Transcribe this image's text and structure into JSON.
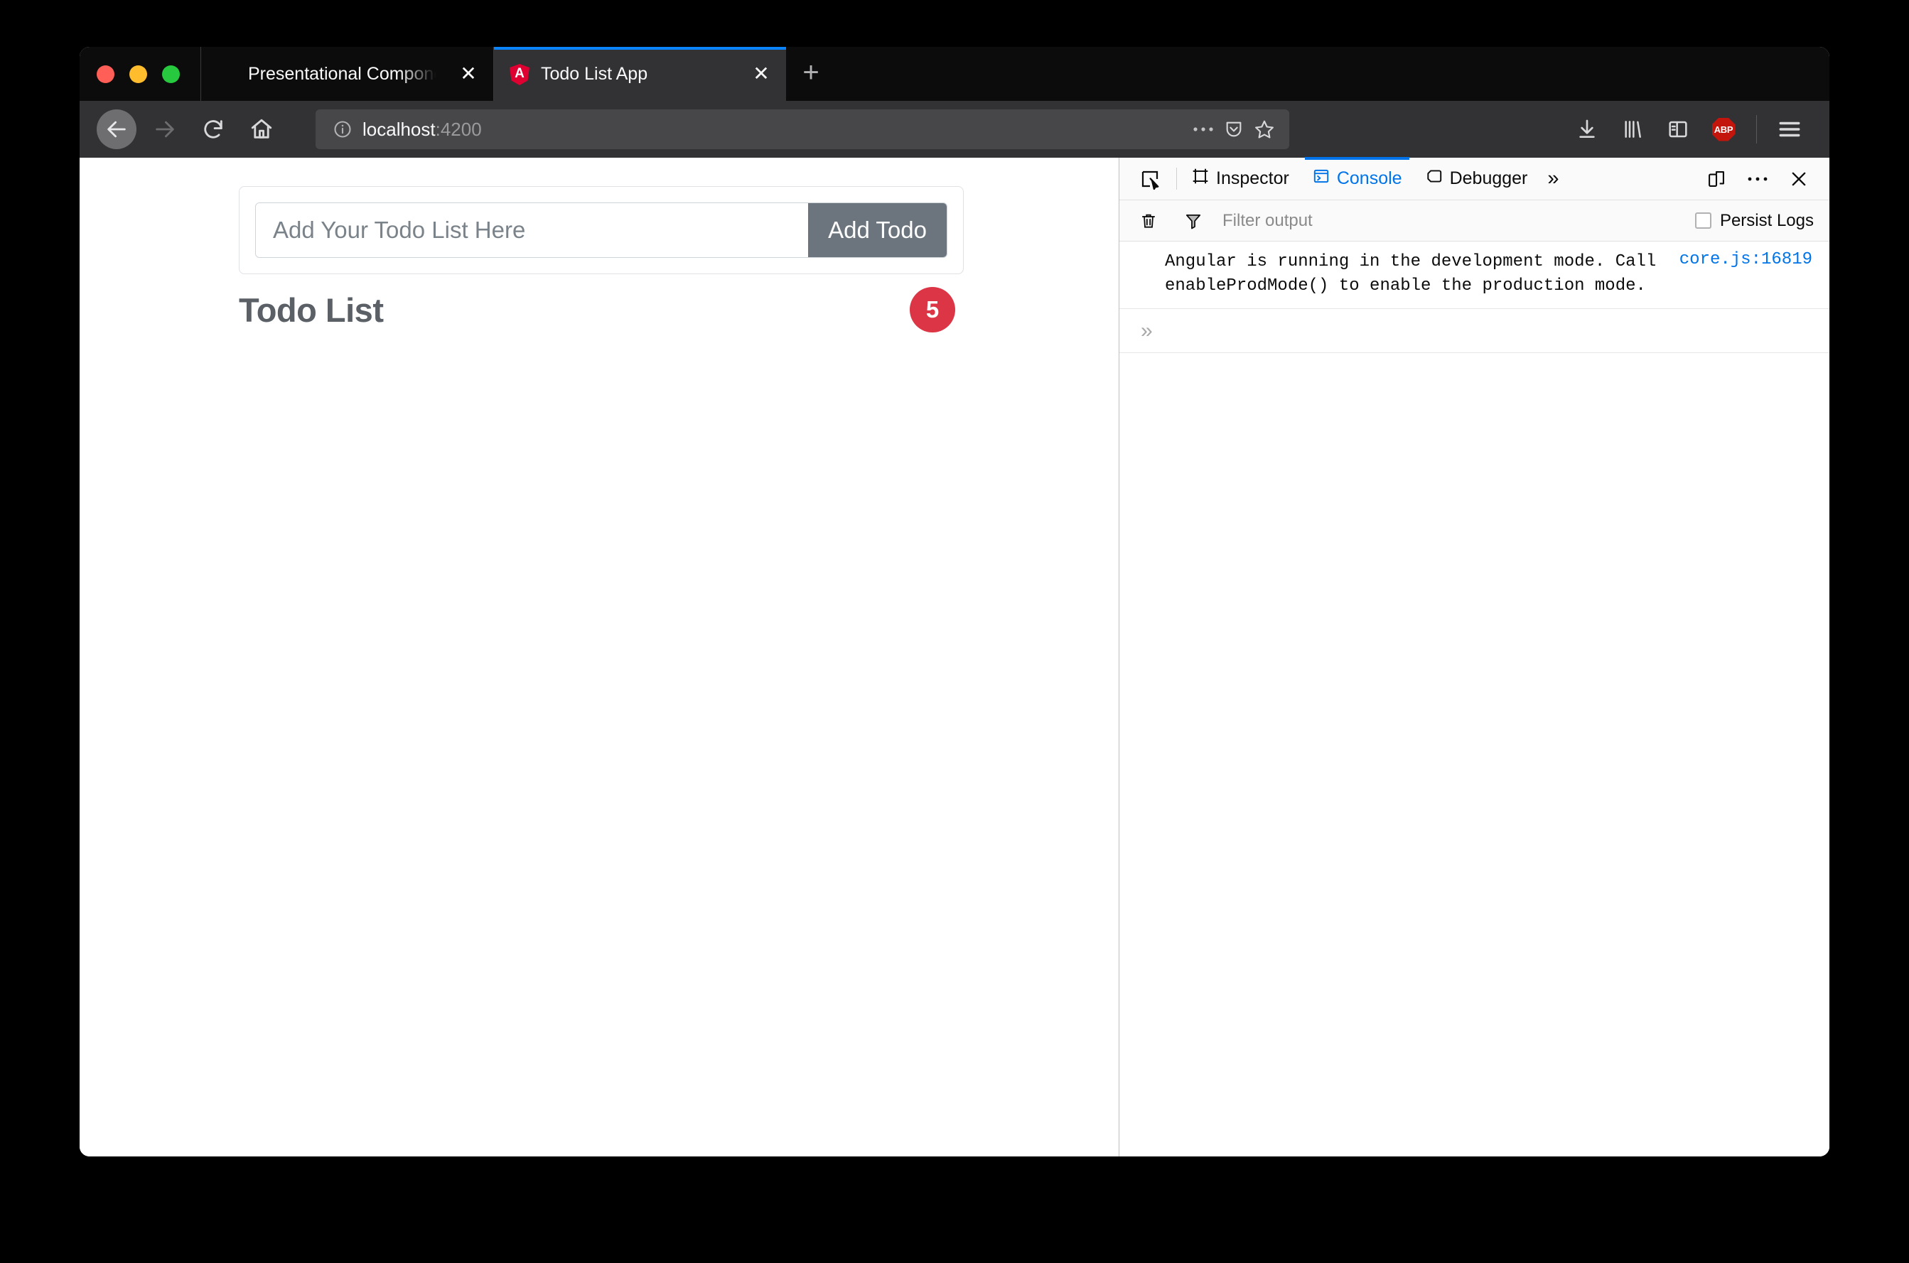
{
  "browser": {
    "tabs": [
      {
        "title": "Presentational Component - To",
        "favicon": "book-icon",
        "active": false,
        "close_label": "✕"
      },
      {
        "title": "Todo List App",
        "favicon": "angular-icon",
        "active": true,
        "close_label": "✕"
      }
    ],
    "new_tab_label": "+",
    "nav": {
      "back": "back-arrow-icon",
      "forward": "forward-arrow-icon",
      "reload": "reload-icon",
      "home": "home-icon"
    },
    "url": {
      "host": "localhost",
      "port": ":4200",
      "info_icon": "info-circle-icon",
      "page_actions_icon": "ellipsis-icon",
      "pocket_icon": "pocket-icon",
      "bookmark_icon": "star-icon"
    },
    "toolbar_right": {
      "downloads_icon": "download-icon",
      "library_icon": "library-icon",
      "sidebar_icon": "sidebar-icon",
      "adblock_label": "ABP",
      "menu_icon": "hamburger-menu-icon"
    },
    "traffic_lights": {
      "close": "#ff5f56",
      "minimize": "#ffbd2e",
      "zoom": "#27c93f"
    }
  },
  "app": {
    "input_placeholder": "Add Your Todo List Here",
    "input_value": "",
    "add_button_label": "Add Todo",
    "list_title": "Todo List",
    "badge_count": "5",
    "badge_color": "#dc3545"
  },
  "devtools": {
    "picker_icon": "element-picker-icon",
    "tabs": [
      {
        "label": "Inspector",
        "icon": "inspector-icon",
        "active": false
      },
      {
        "label": "Console",
        "icon": "console-icon",
        "active": true
      },
      {
        "label": "Debugger",
        "icon": "debugger-icon",
        "active": false
      }
    ],
    "overflow_label": "»",
    "responsive_icon": "responsive-design-mode-icon",
    "meatball_label": "•••",
    "close_label": "✕",
    "filter": {
      "clear_icon": "trash-icon",
      "funnel_icon": "funnel-icon",
      "placeholder": "Filter output",
      "value": "",
      "persist_label": "Persist Logs",
      "persist_checked": false
    },
    "console": {
      "messages": [
        {
          "text": "Angular is running in the development mode. Call enableProdMode() to enable the production mode.",
          "source": "core.js:16819"
        }
      ],
      "prompt": "»",
      "prompt_value": ""
    }
  },
  "accent": {
    "tab_active_line": "#0a84ff",
    "devtools_active": "#0074e8",
    "add_button": "#6c757d"
  }
}
